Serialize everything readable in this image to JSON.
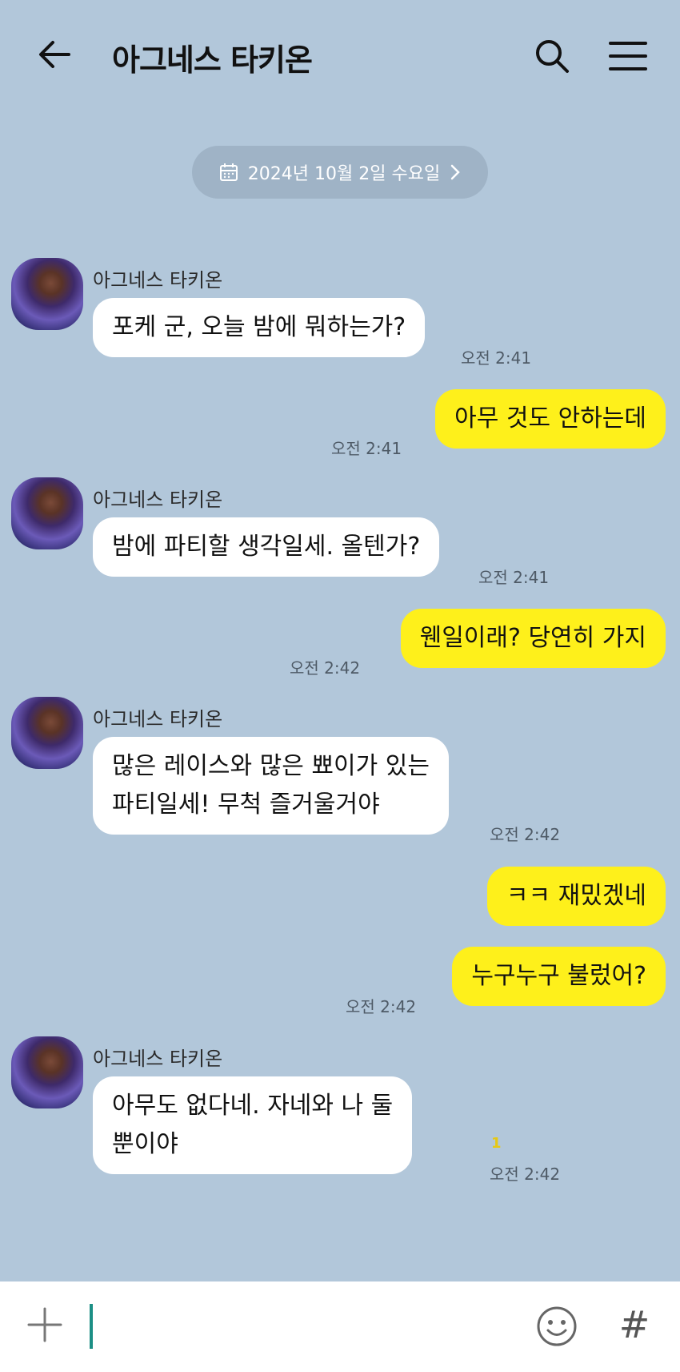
{
  "header": {
    "title": "아그네스 타키온",
    "back_icon": "arrow-left-icon",
    "search_icon": "search-icon",
    "menu_icon": "hamburger-menu-icon"
  },
  "date_divider": {
    "label": "2024년 10월 2일 수요일",
    "icon": "calendar-icon"
  },
  "messages": [
    {
      "side": "in",
      "sender": "아그네스 타키온",
      "text": "포케 군, 오늘 밤에 뭐하는가?",
      "time": "오전 2:41"
    },
    {
      "side": "out",
      "text": "아무 것도 안하는데",
      "time": "오전 2:41"
    },
    {
      "side": "in",
      "sender": "아그네스 타키온",
      "text": "밤에 파티할 생각일세. 올텐가?",
      "time": "오전 2:41"
    },
    {
      "side": "out",
      "text": "웬일이래? 당연히 가지",
      "time": "오전 2:42"
    },
    {
      "side": "in",
      "sender": "아그네스 타키온",
      "text_line1": "많은 레이스와 많은 뾰이가 있는",
      "text_line2": "파티일세! 무척 즐거울거야",
      "time": "오전 2:42"
    },
    {
      "side": "out",
      "text": "ㅋㅋ 재밌겠네"
    },
    {
      "side": "out",
      "text": "누구누구 불렀어?",
      "time": "오전 2:42"
    },
    {
      "side": "in",
      "sender": "아그네스 타키온",
      "text_line1": "아무도 없다네. 자네와 나 둘",
      "text_line2": "뿐이야",
      "unread": "1",
      "time": "오전 2:42"
    }
  ],
  "input_bar": {
    "plus_icon": "plus-icon",
    "emoji_icon": "emoji-icon",
    "hash_label": "#"
  },
  "colors": {
    "background": "#b2c7da",
    "outgoing_bubble": "#fef01b",
    "incoming_bubble": "#ffffff",
    "caret": "#1c8f85"
  }
}
